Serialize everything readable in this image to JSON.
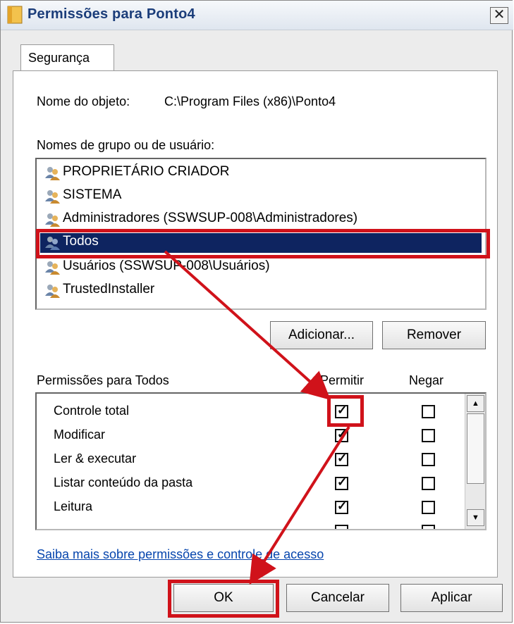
{
  "window": {
    "title": "Permissões para Ponto4",
    "close_label": "✕"
  },
  "tab": {
    "label": "Segurança"
  },
  "object": {
    "label": "Nome do objeto:",
    "value": "C:\\Program Files (x86)\\Ponto4"
  },
  "groups": {
    "label": "Nomes de grupo ou de usuário:",
    "items": [
      {
        "label": "PROPRIETÁRIO CRIADOR",
        "icon": "users-icon"
      },
      {
        "label": "SISTEMA",
        "icon": "users-icon"
      },
      {
        "label": "Administradores (SSWSUP-008\\Administradores)",
        "icon": "users-icon"
      },
      {
        "label": "Todos",
        "icon": "users-icon",
        "selected": true
      },
      {
        "label": "Usuários (SSWSUP-008\\Usuários)",
        "icon": "users-icon"
      },
      {
        "label": "TrustedInstaller",
        "icon": "users-icon"
      }
    ]
  },
  "buttons": {
    "add": "Adicionar...",
    "remove": "Remover",
    "ok": "OK",
    "cancel": "Cancelar",
    "apply": "Aplicar"
  },
  "permissions": {
    "label": "Permissões para Todos",
    "allow_header": "Permitir",
    "deny_header": "Negar",
    "rows": [
      {
        "name": "Controle total",
        "allow": true,
        "deny": false
      },
      {
        "name": "Modificar",
        "allow": true,
        "deny": false
      },
      {
        "name": "Ler & executar",
        "allow": true,
        "deny": false
      },
      {
        "name": "Listar conteúdo da pasta",
        "allow": true,
        "deny": false
      },
      {
        "name": "Leitura",
        "allow": true,
        "deny": false
      }
    ]
  },
  "help_link": "Saiba mais sobre permissões e controle de acesso",
  "colors": {
    "selection": "#0e2460",
    "highlight": "#d0121a",
    "title": "#1b3d7a",
    "link": "#0645ad"
  }
}
